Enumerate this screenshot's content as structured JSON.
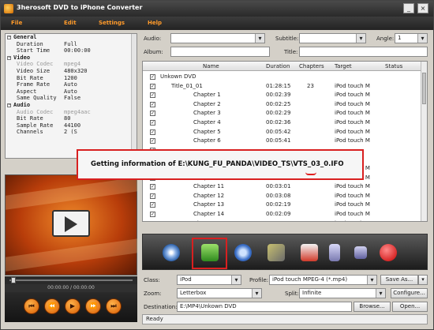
{
  "window": {
    "title": "3herosoft DVD to iPhone Converter",
    "minimize": "_",
    "close": "×"
  },
  "menu": [
    "File",
    "Edit",
    "Settings",
    "Help"
  ],
  "properties": [
    {
      "type": "section",
      "key": "General"
    },
    {
      "key": "Duration",
      "value": "Full"
    },
    {
      "key": "Start Time",
      "value": "00:00:00"
    },
    {
      "type": "section",
      "key": "Video"
    },
    {
      "key": "Video Codec",
      "value": "mpeg4",
      "dim": true
    },
    {
      "key": "Video Size",
      "value": "480x320"
    },
    {
      "key": "Bit Rate",
      "value": "1200"
    },
    {
      "key": "Frame Rate",
      "value": "Auto"
    },
    {
      "key": "Aspect",
      "value": "Auto"
    },
    {
      "key": "Same Quality",
      "value": "False"
    },
    {
      "type": "section",
      "key": "Audio"
    },
    {
      "key": "Audio Codec",
      "value": "mpeg4aac",
      "dim": true
    },
    {
      "key": "Bit Rate",
      "value": "80"
    },
    {
      "key": "Sample Rate",
      "value": "44100"
    },
    {
      "key": "Channels",
      "value": "2 (S"
    }
  ],
  "preview": {
    "timecode": "00:00:00 / 00:00:00"
  },
  "transport": [
    "⏮",
    "⏪",
    "▶",
    "⏩",
    "⏭"
  ],
  "fields": {
    "audio_label": "Audio:",
    "subtitle_label": "Subtitle:",
    "angle_label": "Angle:",
    "angle_value": "1",
    "album_label": "Album:",
    "title_label": "Title:"
  },
  "table": {
    "headers": {
      "name": "Name",
      "duration": "Duration",
      "chapters": "Chapters",
      "target": "Target",
      "status": "Status"
    },
    "rows": [
      {
        "indent": 0,
        "name": "Unkown DVD",
        "duration": "",
        "chapters": "",
        "target": ""
      },
      {
        "indent": 1,
        "name": "Title_01_01",
        "duration": "01:28:15",
        "chapters": "23",
        "target": "iPod touch M"
      },
      {
        "indent": 2,
        "name": "Chapter 1",
        "duration": "00:02:39",
        "chapters": "",
        "target": "iPod touch M"
      },
      {
        "indent": 2,
        "name": "Chapter 2",
        "duration": "00:02:25",
        "chapters": "",
        "target": "iPod touch M"
      },
      {
        "indent": 2,
        "name": "Chapter 3",
        "duration": "00:02:29",
        "chapters": "",
        "target": "iPod touch M"
      },
      {
        "indent": 2,
        "name": "Chapter 4",
        "duration": "00:02:36",
        "chapters": "",
        "target": "iPod touch M"
      },
      {
        "indent": 2,
        "name": "Chapter 5",
        "duration": "00:05:42",
        "chapters": "",
        "target": "iPod touch M"
      },
      {
        "indent": 2,
        "name": "Chapter 6",
        "duration": "00:05:41",
        "chapters": "",
        "target": "iPod touch M"
      },
      {
        "indent": 2,
        "name": "",
        "duration": "",
        "chapters": "",
        "target": ""
      },
      {
        "indent": 2,
        "name": "",
        "duration": "",
        "chapters": "",
        "target": ""
      },
      {
        "indent": 2,
        "name": "Chapter 9",
        "duration": "",
        "chapters": "",
        "target": "iPod touch M"
      },
      {
        "indent": 2,
        "name": "Chapter 10",
        "duration": "00:02:55",
        "chapters": "",
        "target": "iPod touch M"
      },
      {
        "indent": 2,
        "name": "Chapter 11",
        "duration": "00:03:01",
        "chapters": "",
        "target": "iPod touch M"
      },
      {
        "indent": 2,
        "name": "Chapter 12",
        "duration": "00:03:08",
        "chapters": "",
        "target": "iPod touch M"
      },
      {
        "indent": 2,
        "name": "Chapter 13",
        "duration": "00:02:19",
        "chapters": "",
        "target": "iPod touch M"
      },
      {
        "indent": 2,
        "name": "Chapter 14",
        "duration": "00:02:09",
        "chapters": "",
        "target": "iPod touch M"
      },
      {
        "indent": 2,
        "name": "Chapter 15",
        "duration": "00:04:02",
        "chapters": "",
        "target": "iPod touch M"
      }
    ]
  },
  "toolbar_icons": [
    "dvd-load-icon",
    "convert-icon",
    "snapshot-icon",
    "edit-icon",
    "list-icon",
    "pause-icon",
    "stop-icon",
    "record-icon"
  ],
  "settings": {
    "class_label": "Class:",
    "class_value": "iPod",
    "profile_label": "Profile:",
    "profile_value": "iPod touch MPEG-4  (*.mp4)",
    "save_as": "Save As...",
    "zoom_label": "Zoom:",
    "zoom_value": "Letterbox",
    "split_label": "Split:",
    "split_value": "Infinite",
    "configure": "Configure...",
    "dest_label": "Destination:",
    "dest_value": "E:\\MP4\\Unkown DVD",
    "browse": "Browse...",
    "open": "Open..."
  },
  "status": "Ready",
  "dialog": {
    "message": "Getting information of E:\\KUNG_FU_PANDA\\VIDEO_TS\\VTS_03_0.IFO"
  }
}
